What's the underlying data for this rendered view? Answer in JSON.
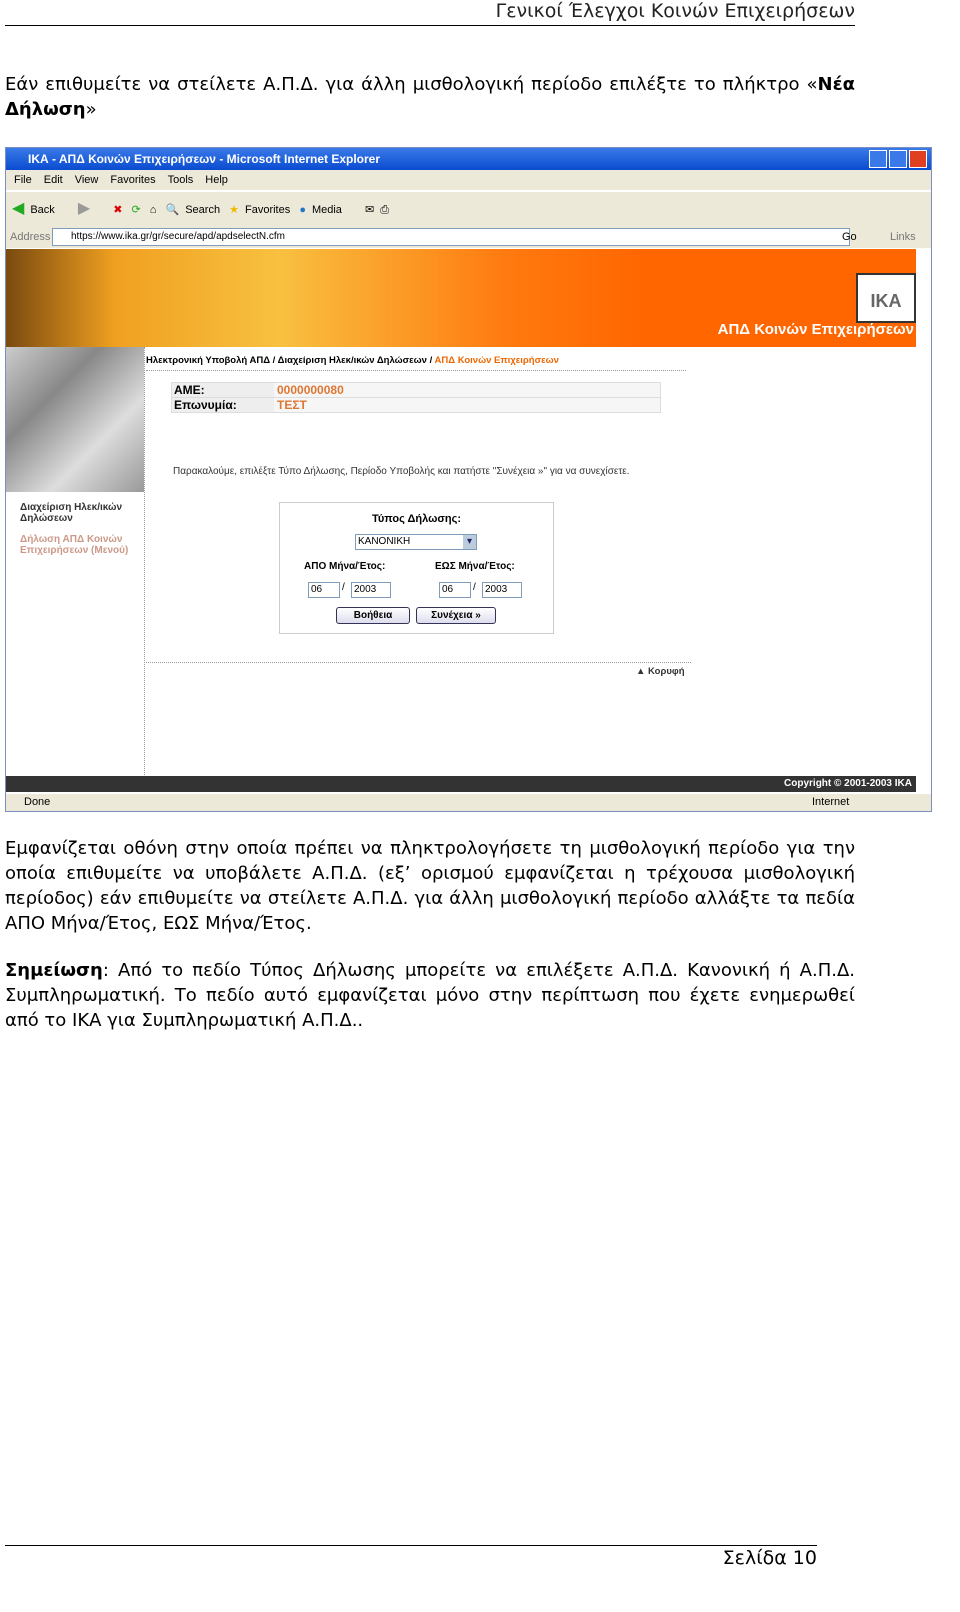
{
  "header": {
    "title": "Γενικοί Έλεγχοι Κοινών Επιχειρήσεων"
  },
  "intro": {
    "text": "Εάν επιθυμείτε να στείλετε Α.Π.Δ. για άλλη μισθολογική περίοδο επιλέξτε το πλήκτρο «",
    "bold": "Νέα Δήλωση",
    "end": "»"
  },
  "browser": {
    "title": "ΙΚΑ - ΑΠΔ Κοινών Επιχειρήσεων - Microsoft Internet Explorer",
    "menu": [
      "File",
      "Edit",
      "View",
      "Favorites",
      "Tools",
      "Help"
    ],
    "toolbar": [
      "Back",
      "Search",
      "Favorites",
      "Media"
    ],
    "address_label": "Address",
    "url": "https://www.ika.gr/gr/secure/apd/apdselectN.cfm",
    "go": "Go",
    "links": "Links",
    "status": "Done",
    "zone": "Internet"
  },
  "site": {
    "logo": "IKA",
    "banner_title": "ΑΠΔ Κοινών Επιχειρήσεων",
    "breadcrumb": [
      "Ηλεκτρονική Υποβολή ΑΠΔ",
      "Διαχείριση Ηλεκ/ικών Δηλώσεων",
      "ΑΠΔ Κοινών Επιχειρήσεων"
    ],
    "ame_label": "ΑΜΕ:",
    "ame_value": "0000000080",
    "name_label": "Επωνυμία:",
    "name_value": "ΤΕΣΤ",
    "instructions": "Παρακαλούμε, επιλέξτε Τύπο Δήλωσης, Περίοδο Υποβολής και πατήστε \"Συνέχεια »\" για να συνεχίσετε.",
    "side_links": [
      "Διαχείριση Ηλεκ/ικών Δηλώσεων",
      "Δήλωση ΑΠΔ Κοινών Επιχειρήσεων (Μενού)"
    ],
    "type_label": "Τύπος Δήλωσης:",
    "type_value": "ΚΑΝΟΝΙΚΗ",
    "from_label": "ΑΠΟ Μήνα/Έτος:",
    "to_label": "ΕΩΣ Μήνα/Έτος:",
    "from_month": "06",
    "from_year": "2003",
    "to_month": "06",
    "to_year": "2003",
    "sep": "/",
    "help_btn": "Βοήθεια",
    "next_btn": "Συνέχεια »",
    "top_link": "▲ Κορυφή",
    "copyright": "Copyright © 2001-2003 IKA",
    "accent": "#ff6600"
  },
  "body": {
    "para1": "Εμφανίζεται οθόνη στην οποία πρέπει να πληκτρολογήσετε τη μισθολογική περίοδο για την οποία επιθυμείτε να υποβάλετε Α.Π.Δ. (εξ’ ορισμού εμφανίζεται η τρέχουσα μισθολογική περίοδος) εάν επιθυμείτε να στείλετε Α.Π.Δ. για άλλη μισθολογική περίοδο αλλάξτε τα πεδία ΑΠΟ Μήνα/Έτος, ΕΩΣ Μήνα/Έτος.",
    "note_label": "Σημείωση",
    "note": ": Από το πεδίο Τύπος Δήλωσης μπορείτε να επιλέξετε Α.Π.Δ. Κανονική ή Α.Π.Δ. Συμπληρωματική. Το πεδίο αυτό εμφανίζεται μόνο στην περίπτωση που έχετε ενημερωθεί από το ΙΚΑ για Συμπληρωματική Α.Π.Δ.."
  },
  "footer": {
    "page": "Σελίδα 10"
  }
}
